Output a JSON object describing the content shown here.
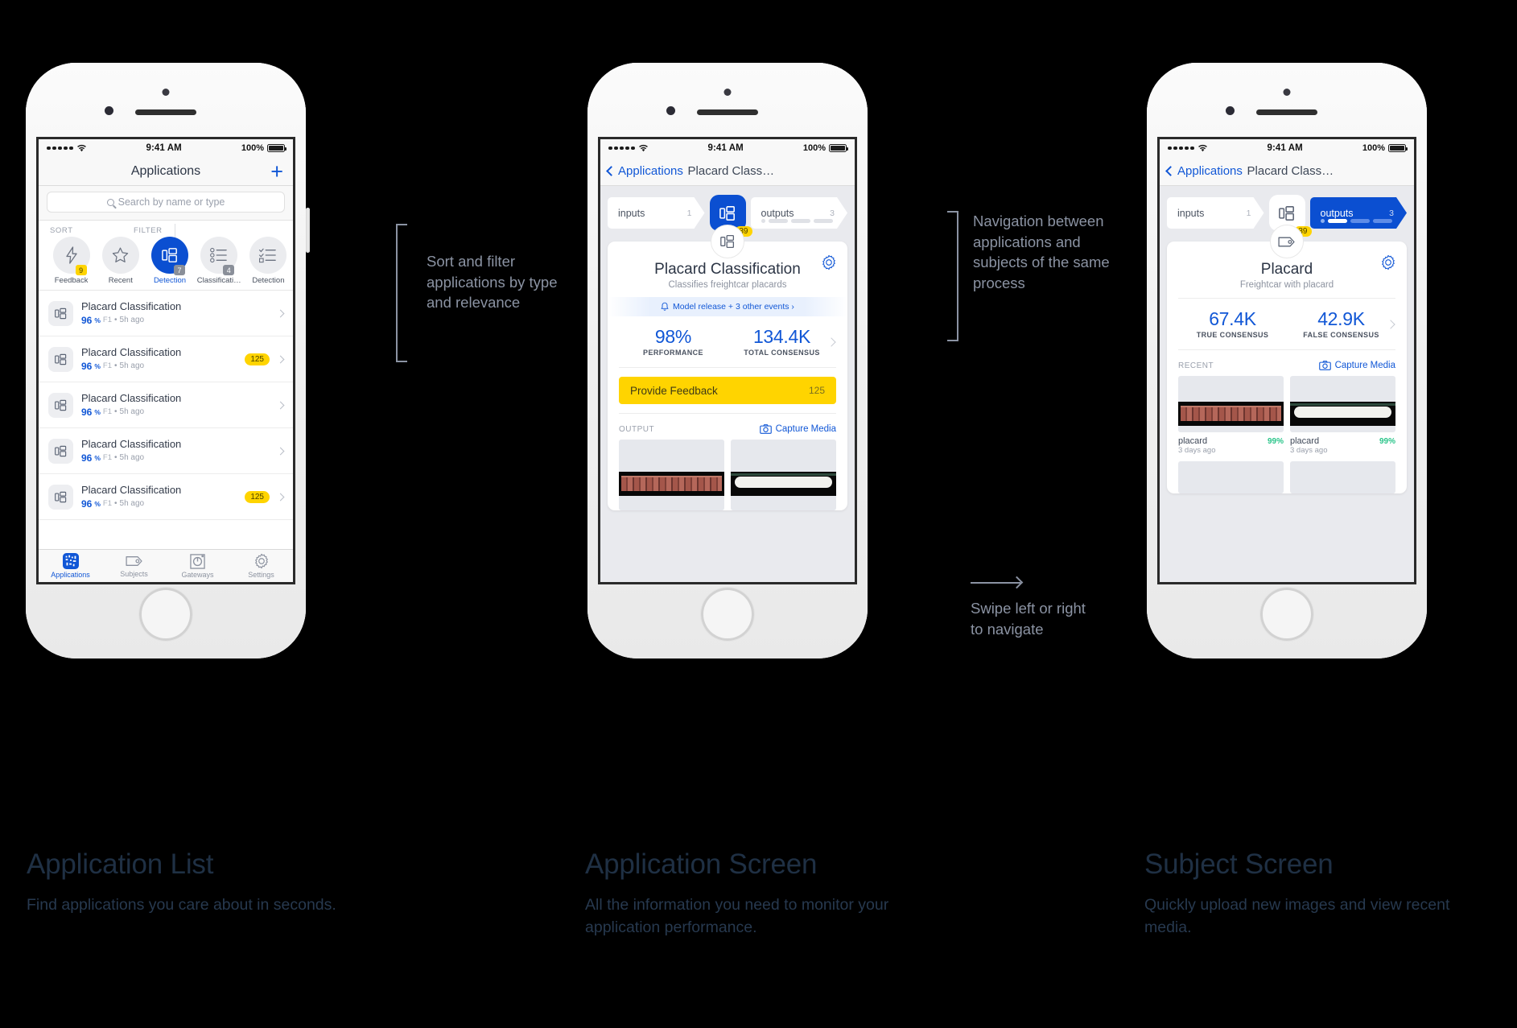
{
  "colors": {
    "accent": "#1157d6",
    "accent_dark": "#0b4fd1",
    "yellow": "#ffd400",
    "green": "#29c489",
    "caption": "#1f3044",
    "anno": "#8b93a3"
  },
  "status_bar": {
    "time": "9:41 AM",
    "battery": "100%"
  },
  "phone1": {
    "nav": {
      "title": "Applications",
      "add_icon": "plus-icon"
    },
    "search": {
      "placeholder": "Search by name or type",
      "icon": "search-icon"
    },
    "sort_label": "SORT",
    "filter_label": "FILTER",
    "chips": [
      {
        "label": "Feedback",
        "icon": "bolt-icon",
        "badge": "9",
        "badge_style": "yellow",
        "active": false
      },
      {
        "label": "Recent",
        "icon": "star-icon",
        "badge": "",
        "badge_style": "",
        "active": false
      },
      {
        "label": "Detection",
        "icon": "detection-icon",
        "badge": "7",
        "badge_style": "gray",
        "active": true
      },
      {
        "label": "Classificati…",
        "icon": "classification-icon",
        "badge": "4",
        "badge_style": "gray",
        "active": false
      },
      {
        "label": "Detection",
        "icon": "checklist-icon",
        "badge": "",
        "badge_style": "",
        "active": false
      }
    ],
    "rows": [
      {
        "title": "Placard Classification",
        "score": "96",
        "pct": "%",
        "metric": "F1",
        "sep": "•",
        "time": "5h ago",
        "pill": ""
      },
      {
        "title": "Placard Classification",
        "score": "96",
        "pct": "%",
        "metric": "F1",
        "sep": "•",
        "time": "5h ago",
        "pill": "125"
      },
      {
        "title": "Placard Classification",
        "score": "96",
        "pct": "%",
        "metric": "F1",
        "sep": "•",
        "time": "5h ago",
        "pill": ""
      },
      {
        "title": "Placard Classification",
        "score": "96",
        "pct": "%",
        "metric": "F1",
        "sep": "•",
        "time": "5h ago",
        "pill": ""
      },
      {
        "title": "Placard Classification",
        "score": "96",
        "pct": "%",
        "metric": "F1",
        "sep": "•",
        "time": "5h ago",
        "pill": "125"
      }
    ],
    "tabs": [
      {
        "label": "Applications",
        "icon": "applications-icon",
        "active": true
      },
      {
        "label": "Subjects",
        "icon": "tag-icon",
        "active": false
      },
      {
        "label": "Gateways",
        "icon": "gateway-icon",
        "active": false
      },
      {
        "label": "Settings",
        "icon": "gear-icon",
        "active": false
      }
    ]
  },
  "phone2": {
    "nav": {
      "back": "Applications",
      "title": "Placard Class…",
      "back_icon": "chevron-left-icon"
    },
    "process": {
      "inputs_label": "inputs",
      "inputs_count": "1",
      "center_icon": "detection-icon",
      "center_badge": "39",
      "outputs_label": "outputs",
      "outputs_count": "3"
    },
    "card": {
      "float_icon": "detection-icon",
      "gear_icon": "gear-icon",
      "title": "Placard Classification",
      "subtitle": "Classifies freightcar placards",
      "event_icon": "bell-icon",
      "event_text": "Model release + 3 other events ›",
      "stats": [
        {
          "value": "98%",
          "key": "PERFORMANCE"
        },
        {
          "value": "134.4K",
          "key": "TOTAL CONSENSUS"
        }
      ],
      "feedback_label": "Provide Feedback",
      "feedback_count": "125",
      "output_label": "OUTPUT",
      "capture_label": "Capture Media",
      "capture_icon": "camera-icon"
    }
  },
  "phone3": {
    "nav": {
      "back": "Applications",
      "title": "Placard Class…",
      "back_icon": "chevron-left-icon"
    },
    "process": {
      "inputs_label": "inputs",
      "inputs_count": "1",
      "center_icon": "detection-icon",
      "center_badge": "39",
      "outputs_label": "outputs",
      "outputs_count": "3"
    },
    "card": {
      "float_icon": "tag-icon",
      "gear_icon": "gear-icon",
      "title": "Placard",
      "subtitle": "Freightcar with placard",
      "stats": [
        {
          "value": "67.4K",
          "key": "TRUE CONSENSUS"
        },
        {
          "value": "42.9K",
          "key": "FALSE CONSENSUS"
        }
      ],
      "recent_label": "RECENT",
      "capture_label": "Capture Media",
      "capture_icon": "camera-icon",
      "media": [
        {
          "name": "placard",
          "confidence": "99%",
          "time": "3 days ago"
        },
        {
          "name": "placard",
          "confidence": "99%",
          "time": "3 days ago"
        }
      ]
    }
  },
  "annotations": {
    "a1": "Sort and filter applications by type and relevance",
    "a2": "Navigation between applications and subjects of the same process",
    "a3": "Swipe left or right to navigate"
  },
  "captions": [
    {
      "title": "Application List",
      "body": "Find applications you care about in seconds."
    },
    {
      "title": "Application Screen",
      "body": "All the information you need to monitor your application performance."
    },
    {
      "title": "Subject Screen",
      "body": "Quickly upload new images and view recent media."
    }
  ]
}
